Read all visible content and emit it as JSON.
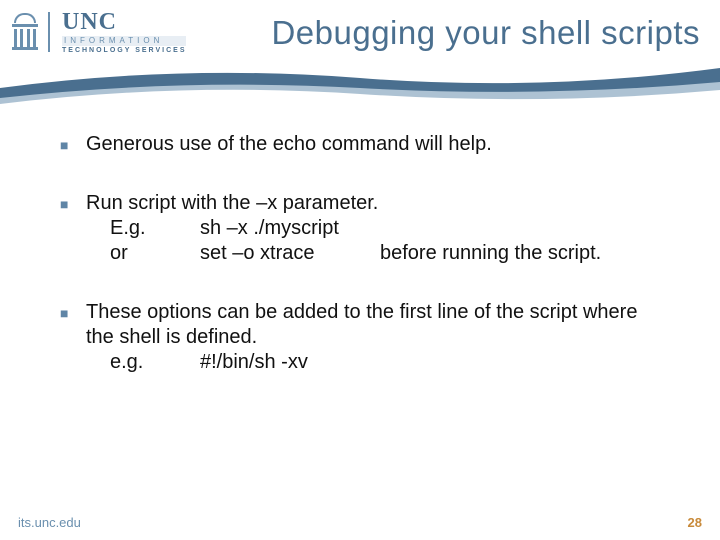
{
  "header": {
    "logo": {
      "name": "UNC",
      "line2": "INFORMATION",
      "line3": "TECHNOLOGY SERVICES"
    },
    "title": "Debugging your shell scripts"
  },
  "bullets": [
    {
      "parts": [
        "Generous use of the ",
        "echo",
        " command will help."
      ]
    },
    {
      "parts": [
        "Run script with the ",
        "–x",
        " parameter."
      ],
      "sub": [
        {
          "label": "E.g.",
          "cmd": "sh –x ./myscript",
          "tail": ""
        },
        {
          "label": "or",
          "cmd": "set –o xtrace",
          "tail": "before running the script."
        }
      ]
    },
    {
      "parts": [
        "These options can be added to the first line of the script where the shell is defined."
      ],
      "sub2": {
        "label": "e.g.",
        "cmd": "#!/bin/sh -xv"
      }
    }
  ],
  "footer": {
    "url": "its.unc.edu",
    "page": "28"
  }
}
